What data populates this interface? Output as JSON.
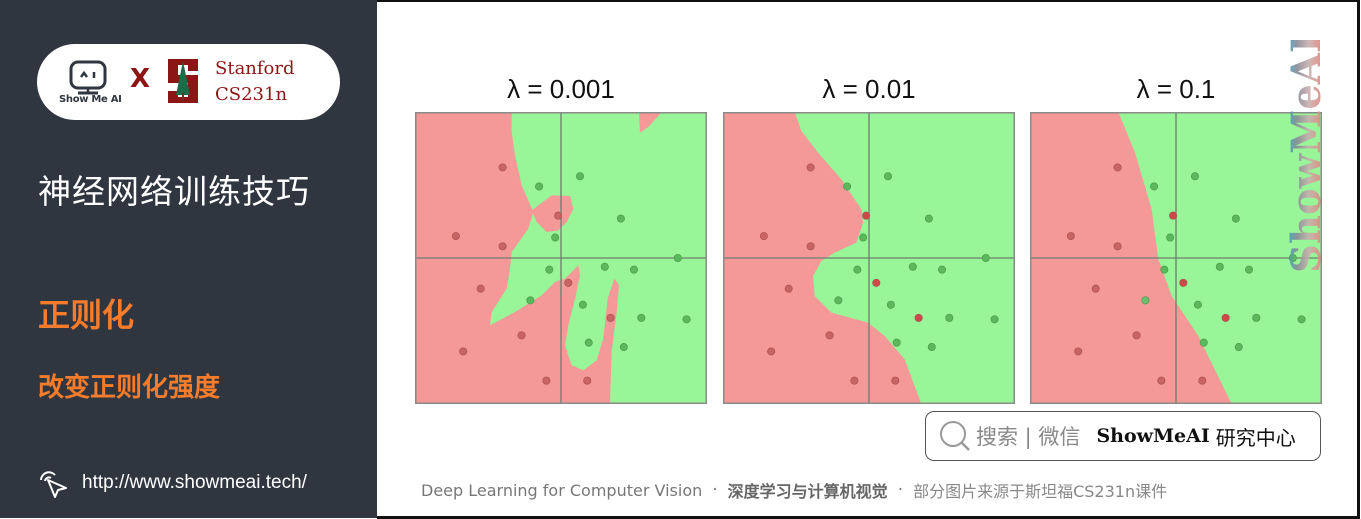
{
  "sidebar": {
    "logo": {
      "brand_text": "Show Me AI",
      "cross": "X",
      "partner_line1": "Stanford",
      "partner_line2": "CS231n"
    },
    "title": "神经网络训练技巧",
    "section": "正则化",
    "subsection": "改变正则化强度",
    "url": "http://www.showmeai.tech/"
  },
  "main": {
    "watermark": "ShowMeAI",
    "search": {
      "label": "搜索 | 微信",
      "brand": "ShowMeAI",
      "brand_suffix": "研究中心"
    },
    "footer": {
      "english": "Deep Learning for Computer Vision",
      "separator": "·",
      "chinese": "深度学习与计算机视觉",
      "source": "部分图片来源于斯坦福CS231n课件"
    }
  },
  "colors": {
    "sidebar_bg": "#2f3640",
    "accent_orange": "#f67c2b",
    "stanford_red": "#8c1515",
    "region_red": "#f59898",
    "region_green": "#98f598",
    "dot_red": "#c86464",
    "dot_green": "#5cb85c",
    "dot_red_misclassified": "#d04848"
  },
  "chart_data": [
    {
      "type": "scatter",
      "title": "λ = 0.001",
      "lambda": 0.001,
      "xlim": [
        -1,
        1
      ],
      "ylim": [
        -1,
        1
      ],
      "axes_lines": "x=0, y=0",
      "classes": [
        "red",
        "green"
      ]
    },
    {
      "type": "scatter",
      "title": "λ = 0.01",
      "lambda": 0.01,
      "xlim": [
        -1,
        1
      ],
      "ylim": [
        -1,
        1
      ],
      "axes_lines": "x=0, y=0",
      "classes": [
        "red",
        "green"
      ]
    },
    {
      "type": "scatter",
      "title": "λ = 0.1",
      "lambda": 0.1,
      "xlim": [
        -1,
        1
      ],
      "ylim": [
        -1,
        1
      ],
      "axes_lines": "x=0, y=0",
      "classes": [
        "red",
        "green"
      ]
    }
  ],
  "points": [
    {
      "x": -0.4,
      "y": 0.62,
      "cls": "red"
    },
    {
      "x": -0.15,
      "y": 0.49,
      "cls": "green"
    },
    {
      "x": 0.13,
      "y": 0.56,
      "cls": "green"
    },
    {
      "x": -0.02,
      "y": 0.29,
      "cls": "red"
    },
    {
      "x": 0.41,
      "y": 0.27,
      "cls": "green"
    },
    {
      "x": -0.72,
      "y": 0.15,
      "cls": "red"
    },
    {
      "x": -0.04,
      "y": 0.14,
      "cls": "green"
    },
    {
      "x": -0.4,
      "y": 0.08,
      "cls": "red"
    },
    {
      "x": 0.8,
      "y": 0.0,
      "cls": "green"
    },
    {
      "x": -0.08,
      "y": -0.08,
      "cls": "green"
    },
    {
      "x": 0.3,
      "y": -0.06,
      "cls": "green"
    },
    {
      "x": 0.5,
      "y": -0.08,
      "cls": "green"
    },
    {
      "x": 0.05,
      "y": -0.17,
      "cls": "red"
    },
    {
      "x": -0.55,
      "y": -0.21,
      "cls": "red"
    },
    {
      "x": -0.21,
      "y": -0.29,
      "cls": "green"
    },
    {
      "x": 0.15,
      "y": -0.32,
      "cls": "green"
    },
    {
      "x": 0.34,
      "y": -0.41,
      "cls": "red"
    },
    {
      "x": 0.55,
      "y": -0.41,
      "cls": "green"
    },
    {
      "x": 0.86,
      "y": -0.42,
      "cls": "green"
    },
    {
      "x": -0.27,
      "y": -0.53,
      "cls": "red"
    },
    {
      "x": 0.19,
      "y": -0.58,
      "cls": "green"
    },
    {
      "x": 0.43,
      "y": -0.61,
      "cls": "green"
    },
    {
      "x": -0.67,
      "y": -0.64,
      "cls": "red"
    },
    {
      "x": -0.1,
      "y": -0.84,
      "cls": "red"
    },
    {
      "x": 0.18,
      "y": -0.84,
      "cls": "red"
    }
  ]
}
